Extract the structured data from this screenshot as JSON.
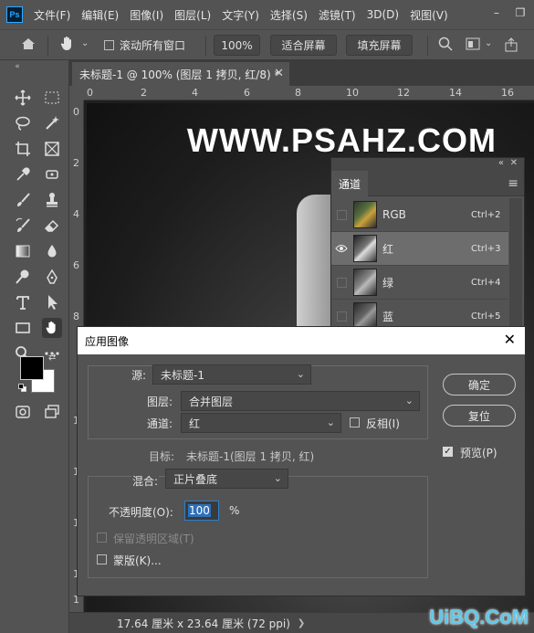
{
  "menubar": {
    "logo": "Ps",
    "items": [
      "文件(F)",
      "编辑(E)",
      "图像(I)",
      "图层(L)",
      "文字(Y)",
      "选择(S)",
      "滤镜(T)",
      "3D(D)",
      "视图(V)"
    ]
  },
  "options": {
    "scroll_all_windows": "滚动所有窗口",
    "zoom": "100%",
    "fit_screen": "适合屏幕",
    "fill_screen": "填充屏幕"
  },
  "document": {
    "tab_title": "未标题-1 @ 100% (图层 1 拷贝, 红/8) *",
    "status": "17.64 厘米 x 23.64 厘米 (72 ppi)",
    "watermark": "WWW.PSAHZ.COM",
    "ruler_h": [
      "0",
      "2",
      "4",
      "6",
      "8",
      "10",
      "12",
      "14",
      "16"
    ],
    "ruler_v": [
      "0",
      "2",
      "4",
      "6",
      "8",
      "1",
      "1",
      "1",
      "1",
      "1",
      "2"
    ]
  },
  "channels_panel": {
    "tab": "通道",
    "rows": [
      {
        "name": "RGB",
        "shortcut": "Ctrl+2",
        "visible": false
      },
      {
        "name": "红",
        "shortcut": "Ctrl+3",
        "visible": true
      },
      {
        "name": "绿",
        "shortcut": "Ctrl+4",
        "visible": false
      },
      {
        "name": "蓝",
        "shortcut": "Ctrl+5",
        "visible": false
      }
    ]
  },
  "dialog": {
    "title": "应用图像",
    "source_label": "源:",
    "source_value": "未标题-1",
    "layer_label": "图层:",
    "layer_value": "合并图层",
    "channel_label": "通道:",
    "channel_value": "红",
    "invert_label": "反相(I)",
    "target_label": "目标:",
    "target_value": "未标题-1(图层 1 拷贝, 红)",
    "blending_label": "混合:",
    "blending_value": "正片叠底",
    "opacity_label": "不透明度(O):",
    "opacity_value": "100",
    "opacity_unit": "%",
    "preserve_label": "保留透明区域(T)",
    "mask_label": "蒙版(K)...",
    "ok": "确定",
    "reset": "复位",
    "preview_label": "预览(P)",
    "preview_checked": true
  },
  "site_badge": "UiBQ.CoM"
}
